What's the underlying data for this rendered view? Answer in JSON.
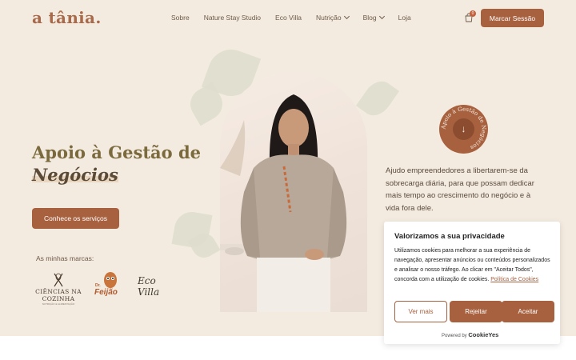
{
  "header": {
    "logo": "a tânia.",
    "nav": [
      {
        "label": "Sobre"
      },
      {
        "label": "Nature Stay Studio"
      },
      {
        "label": "Eco Villa"
      },
      {
        "label": "Nutrição"
      },
      {
        "label": "Blog"
      },
      {
        "label": "Loja"
      }
    ],
    "cart_count": "0",
    "cta_label": "Marcar Sessão"
  },
  "hero": {
    "title_line1": "Apoio à Gestão de",
    "title_line2": "Negócios",
    "button_label": "Conhece os serviços",
    "brands_label": "As minhas marcas:",
    "brands": {
      "ciencias_name": "CIÊNCIAS NA COZINHA",
      "ciencias_sub": "NUTRIÇÃO & ALIMENTAÇÃO",
      "feijao_name": "Feijão",
      "feijao_prefix": "Dr.",
      "ecovilla_line1": "Eco",
      "ecovilla_line2": "Villa"
    },
    "badge_text": "Apoio à Gestão de Negócios",
    "description": "Ajudo empreendedores a libertarem-se da sobrecarga diária, para que possam dedicar mais tempo ao crescimento do negócio e à vida fora dele."
  },
  "cookie": {
    "title": "Valorizamos a sua privacidade",
    "text": "Utilizamos cookies para melhorar a sua experiência de navegação, apresentar anúncios ou conteúdos personalizados e analisar o nosso tráfego. Ao clicar em \"Aceitar Todos\", concorda com a utilização de cookies.",
    "link": "Política de Cookies",
    "buttons": {
      "more": "Ver mais",
      "reject": "Rejeitar",
      "accept": "Aceitar"
    },
    "powered_prefix": "Powered by",
    "powered_brand": "CookieYes"
  },
  "colors": {
    "background": "#f4ebe0",
    "accent": "#a8613f",
    "title": "#7a6a3e"
  }
}
